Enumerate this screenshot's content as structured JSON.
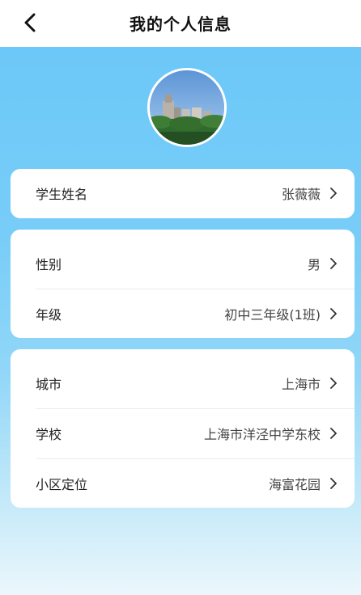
{
  "header": {
    "title": "我的个人信息",
    "back_icon": "chevron-left-icon"
  },
  "profile": {
    "avatar_alt": "avatar"
  },
  "groups": [
    {
      "rows": [
        {
          "label": "学生姓名",
          "value": "张薇薇"
        }
      ]
    },
    {
      "rows": [
        {
          "label": "性别",
          "value": "男"
        },
        {
          "label": "年级",
          "value": "初中三年级(1班)"
        }
      ]
    },
    {
      "rows": [
        {
          "label": "城市",
          "value": "上海市"
        },
        {
          "label": "学校",
          "value": "上海市洋泾中学东校"
        },
        {
          "label": "小区定位",
          "value": "海富花园"
        }
      ]
    }
  ],
  "colors": {
    "accent": "#6cc8f8",
    "card": "#ffffff",
    "text": "#222222",
    "value_text": "#444444"
  }
}
